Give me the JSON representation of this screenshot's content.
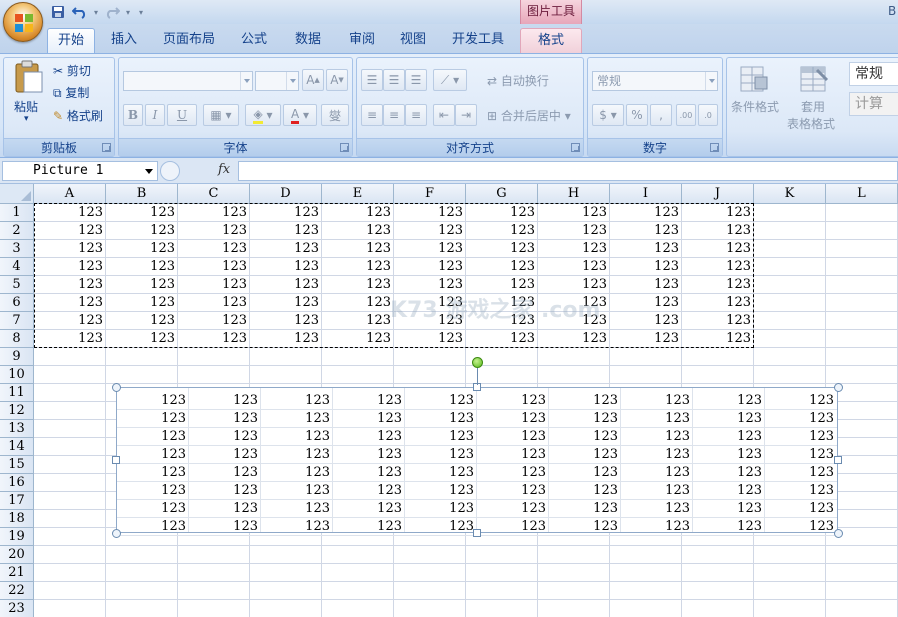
{
  "title_bar": {
    "context_tools_label": "图片工具",
    "title_partial": "B"
  },
  "tabs": [
    "开始",
    "插入",
    "页面布局",
    "公式",
    "数据",
    "审阅",
    "视图",
    "开发工具",
    "格式"
  ],
  "active_tab": "开始",
  "ribbon": {
    "clipboard": {
      "paste": "粘贴",
      "cut": "剪切",
      "copy": "复制",
      "format_painter": "格式刷",
      "group_label": "剪贴板"
    },
    "font": {
      "group_label": "字体",
      "bold": "B",
      "italic": "I",
      "underline": "U",
      "phonetic": "燮"
    },
    "alignment": {
      "group_label": "对齐方式",
      "wrap_text": "自动换行",
      "merge_center": "合并后居中"
    },
    "number": {
      "group_label": "数字",
      "format_value": "常规",
      "percent": "%",
      "comma": ",",
      "inc_decimal": "←.0\n.00",
      "dec_decimal": ".00\n→.0"
    },
    "styles": {
      "conditional_formatting": "条件格式",
      "format_as_table_1": "套用",
      "format_as_table_2": "表格格式",
      "style_normal": "常规",
      "style_calc": "计算"
    }
  },
  "formula_bar": {
    "name_box": "Picture 1",
    "fx_label": "fx",
    "formula": ""
  },
  "sheet": {
    "columns": [
      "A",
      "B",
      "C",
      "D",
      "E",
      "F",
      "G",
      "H",
      "I",
      "J",
      "K",
      "L"
    ],
    "rows": [
      "1",
      "2",
      "3",
      "4",
      "5",
      "6",
      "7",
      "8",
      "9",
      "10",
      "11",
      "12",
      "13",
      "14",
      "15",
      "16",
      "17",
      "18",
      "19",
      "20",
      "21",
      "22",
      "23"
    ],
    "cell_value": "123",
    "data_rows": 8,
    "data_cols": 10
  },
  "watermark": "K73 游戏之家 .com"
}
